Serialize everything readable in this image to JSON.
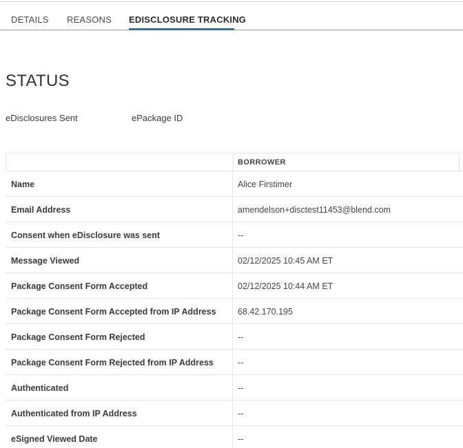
{
  "tabs": [
    {
      "label": "DETAILS"
    },
    {
      "label": "REASONS"
    },
    {
      "label": "EDISCLOSURE TRACKING"
    }
  ],
  "status": {
    "heading": "STATUS",
    "summary": [
      "eDisclosures Sent",
      "ePackage ID"
    ]
  },
  "table": {
    "column_headers": [
      "",
      "BORROWER"
    ],
    "rows": [
      {
        "label": "Name",
        "value": "Alice Firstimer"
      },
      {
        "label": "Email Address",
        "value": "amendelson+disctest11453@blend.com"
      },
      {
        "label": "Consent when eDisclosure was sent",
        "value": "--"
      },
      {
        "label": "Message Viewed",
        "value": "02/12/2025 10:45 AM ET"
      },
      {
        "label": "Package Consent Form Accepted",
        "value": "02/12/2025 10:44 AM ET"
      },
      {
        "label": "Package Consent Form Accepted from IP Address",
        "value": "68.42.170.195"
      },
      {
        "label": "Package Consent Form Rejected",
        "value": "--"
      },
      {
        "label": "Package Consent Form Rejected from IP Address",
        "value": "--"
      },
      {
        "label": "Authenticated",
        "value": "--"
      },
      {
        "label": "Authenticated from IP Address",
        "value": "--"
      },
      {
        "label": "eSigned Viewed Date",
        "value": "--"
      }
    ]
  },
  "colors": {
    "accent": "#2f6fa8",
    "text": "#333333",
    "border": "#e6e6e6"
  }
}
